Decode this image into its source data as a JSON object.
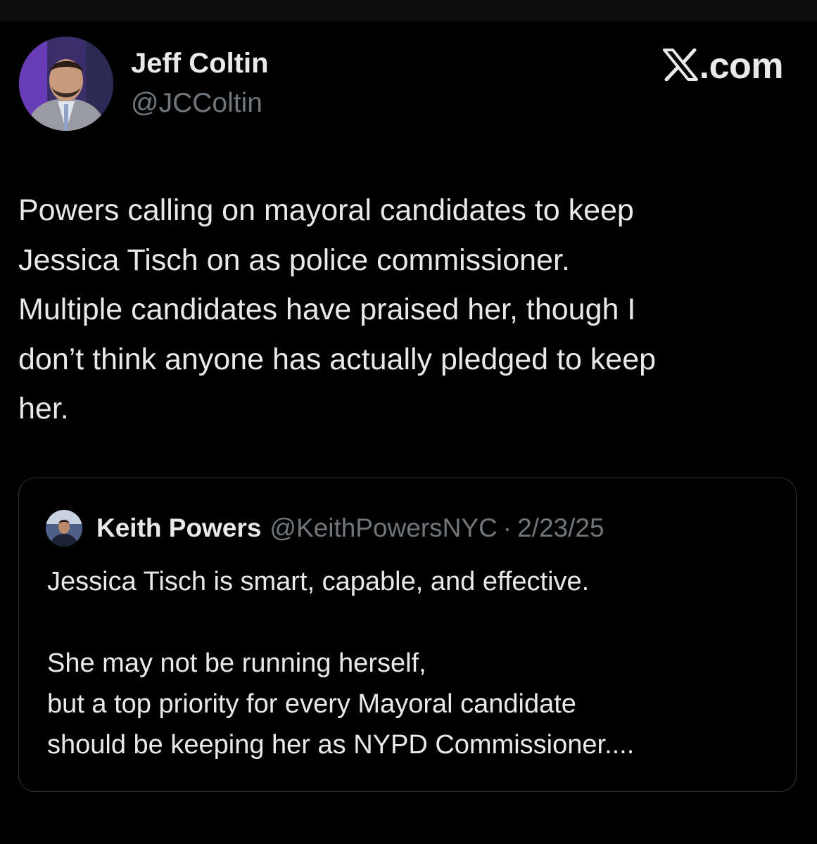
{
  "tweet": {
    "author": {
      "name": "Jeff Coltin",
      "handle": "@JCColtin",
      "avatar_icon": "profile-photo"
    },
    "brand": {
      "icon": "x-logo-icon",
      "text": ".com"
    },
    "text": "Powers calling on mayoral candidates to keep\nJessica Tisch on as police commissioner.\nMultiple candidates have praised her, though I\ndon’t think anyone has actually pledged to keep\nher.",
    "quoted": {
      "author_name": "Keith Powers",
      "handle": "@KeithPowersNYC",
      "separator": "·",
      "date": "2/23/25",
      "avatar_icon": "profile-photo",
      "text": "Jessica Tisch is smart, capable, and effective.\n\nShe may not be running herself,\nbut a top priority for every Mayoral candidate\nshould be keeping her as NYPD Commissioner...."
    }
  },
  "colors": {
    "background": "#000000",
    "primary_text": "#e7e9ea",
    "secondary_text": "#71767b",
    "border": "#2f3336"
  }
}
